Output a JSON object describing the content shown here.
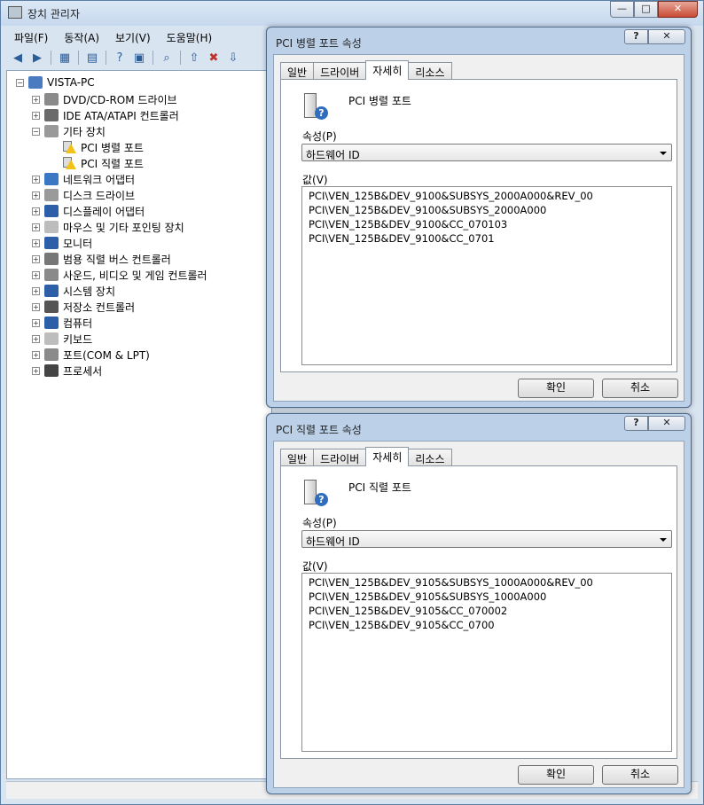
{
  "main": {
    "title": "장치 관리자",
    "menu": [
      "파일(F)",
      "동작(A)",
      "보기(V)",
      "도움말(H)"
    ],
    "caption": {
      "minimize": "—",
      "maximize": "□",
      "close": "✕"
    },
    "tree": {
      "root": "VISTA-PC",
      "items": [
        {
          "label": "DVD/CD-ROM 드라이브",
          "icon": "dvd-drive-icon",
          "color": "#8a8a8a"
        },
        {
          "label": "IDE ATA/ATAPI 컨트롤러",
          "icon": "ide-controller-icon",
          "color": "#6a6a6a"
        },
        {
          "label": "기타 장치",
          "icon": "unknown-device-icon",
          "color": "#999999"
        },
        {
          "label": "PCI 병렬 포트",
          "icon": "warning-device-icon",
          "child": true
        },
        {
          "label": "PCI 직렬 포트",
          "icon": "warning-device-icon",
          "child": true
        },
        {
          "label": "네트워크 어댑터",
          "icon": "network-adapter-icon",
          "color": "#3a78c4"
        },
        {
          "label": "디스크 드라이브",
          "icon": "disk-drive-icon",
          "color": "#9a9a9a"
        },
        {
          "label": "디스플레이 어댑터",
          "icon": "display-adapter-icon",
          "color": "#2d5fa8"
        },
        {
          "label": "마우스 및 기타 포인팅 장치",
          "icon": "mouse-icon",
          "color": "#bdbdbd"
        },
        {
          "label": "모니터",
          "icon": "monitor-icon",
          "color": "#2d5fa8"
        },
        {
          "label": "범용 직렬 버스 컨트롤러",
          "icon": "usb-icon",
          "color": "#777777"
        },
        {
          "label": "사운드, 비디오 및 게임 컨트롤러",
          "icon": "speaker-icon",
          "color": "#8a8a8a"
        },
        {
          "label": "시스템 장치",
          "icon": "system-device-icon",
          "color": "#2d5fa8"
        },
        {
          "label": "저장소 컨트롤러",
          "icon": "storage-controller-icon",
          "color": "#555555"
        },
        {
          "label": "컴퓨터",
          "icon": "computer-icon",
          "color": "#2d5fa8"
        },
        {
          "label": "키보드",
          "icon": "keyboard-icon",
          "color": "#bdbdbd"
        },
        {
          "label": "포트(COM & LPT)",
          "icon": "port-icon",
          "color": "#8a8a8a"
        },
        {
          "label": "프로세서",
          "icon": "processor-icon",
          "color": "#444444"
        }
      ]
    }
  },
  "dialog1": {
    "title": "PCI 병렬 포트 속성",
    "tabs": [
      "일반",
      "드라이버",
      "자세히",
      "리소스"
    ],
    "active_tab": "자세히",
    "device_name": "PCI 병렬 포트",
    "property_label": "속성(P)",
    "property_value": "하드웨어 ID",
    "value_label": "값(V)",
    "values": [
      "PCI\\VEN_125B&DEV_9100&SUBSYS_2000A000&REV_00",
      "PCI\\VEN_125B&DEV_9100&SUBSYS_2000A000",
      "PCI\\VEN_125B&DEV_9100&CC_070103",
      "PCI\\VEN_125B&DEV_9100&CC_0701"
    ],
    "ok": "확인",
    "cancel": "취소",
    "help": "?",
    "close": "✕"
  },
  "dialog2": {
    "title": "PCI 직렬 포트 속성",
    "tabs": [
      "일반",
      "드라이버",
      "자세히",
      "리소스"
    ],
    "active_tab": "자세히",
    "device_name": "PCI 직렬 포트",
    "property_label": "속성(P)",
    "property_value": "하드웨어 ID",
    "value_label": "값(V)",
    "values": [
      "PCI\\VEN_125B&DEV_9105&SUBSYS_1000A000&REV_00",
      "PCI\\VEN_125B&DEV_9105&SUBSYS_1000A000",
      "PCI\\VEN_125B&DEV_9105&CC_070002",
      "PCI\\VEN_125B&DEV_9105&CC_0700"
    ],
    "ok": "확인",
    "cancel": "취소",
    "help": "?",
    "close": "✕"
  }
}
